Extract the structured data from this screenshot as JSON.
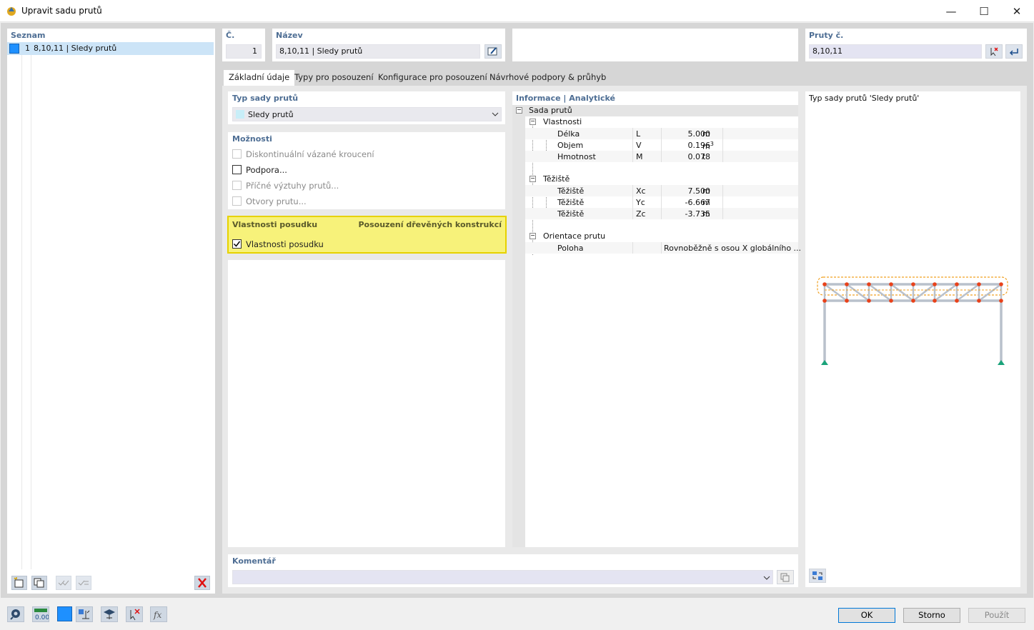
{
  "window": {
    "title": "Upravit sadu prutů",
    "minimize": "—",
    "maximize": "☐",
    "close": "✕"
  },
  "list_panel": {
    "header": "Seznam",
    "items": [
      {
        "number": "1",
        "label": "8,10,11 | Sledy prutů",
        "color": "#1e90ff"
      }
    ]
  },
  "number_field": {
    "label": "Č.",
    "value": "1"
  },
  "name_field": {
    "label": "Název",
    "value": "8,10,11 | Sledy prutů"
  },
  "members_field": {
    "label": "Pruty č.",
    "value": "8,10,11"
  },
  "tabs": [
    "Základní údaje",
    "Typy pro posouzení",
    "Konfigurace pro posouzení",
    "Návrhové podpory & průhyb"
  ],
  "set_type": {
    "header": "Typ sady prutů",
    "selected": "Sledy prutů"
  },
  "options": {
    "header": "Možnosti",
    "items": [
      {
        "label": "Diskontinuální vázané kroucení",
        "checked": false,
        "enabled": false
      },
      {
        "label": "Podpora...",
        "checked": false,
        "enabled": true
      },
      {
        "label": "Příčné výztuhy prutů...",
        "checked": false,
        "enabled": false
      },
      {
        "label": "Otvory prutu...",
        "checked": false,
        "enabled": false
      }
    ]
  },
  "design_props": {
    "header": "Vlastnosti posudku",
    "right_header": "Posouzení dřevěných konstrukcí",
    "checkbox_label": "Vlastnosti posudku",
    "checked": true,
    "highlight_color": "#f7f27a"
  },
  "info": {
    "header": "Informace | Analytické",
    "root": "Sada prutů",
    "groups": [
      {
        "name": "Vlastnosti",
        "rows": [
          {
            "label": "Délka",
            "symbol": "L",
            "value": "5.000",
            "unit": "m"
          },
          {
            "label": "Objem",
            "symbol": "V",
            "value": "0.196",
            "unit": "m",
            "unit_sup": "3"
          },
          {
            "label": "Hmotnost",
            "symbol": "M",
            "value": "0.078",
            "unit": "t"
          }
        ]
      },
      {
        "name": "Těžiště",
        "rows": [
          {
            "label": "Těžiště",
            "symbol": "Xc",
            "value": "7.500",
            "unit": "m"
          },
          {
            "label": "Těžiště",
            "symbol": "Yc",
            "value": "-6.667",
            "unit": "m"
          },
          {
            "label": "Těžiště",
            "symbol": "Zc",
            "value": "-3.735",
            "unit": "m"
          }
        ]
      },
      {
        "name": "Orientace prutu",
        "rows": [
          {
            "label": "Poloha",
            "symbol": "",
            "value": "Rovnoběžně s osou X globálního ...",
            "unit": ""
          }
        ]
      }
    ]
  },
  "preview": {
    "caption": "Typ sady prutů 'Sledy prutů'"
  },
  "comment": {
    "header": "Komentář",
    "value": ""
  },
  "buttons": {
    "ok": "OK",
    "cancel": "Storno",
    "apply": "Použít"
  },
  "colors": {
    "header_text": "#4e6e94",
    "ok_border": "#0078d7",
    "highlight": "#f7f27a",
    "node": "#e8421a",
    "support": "#1aa37a"
  }
}
